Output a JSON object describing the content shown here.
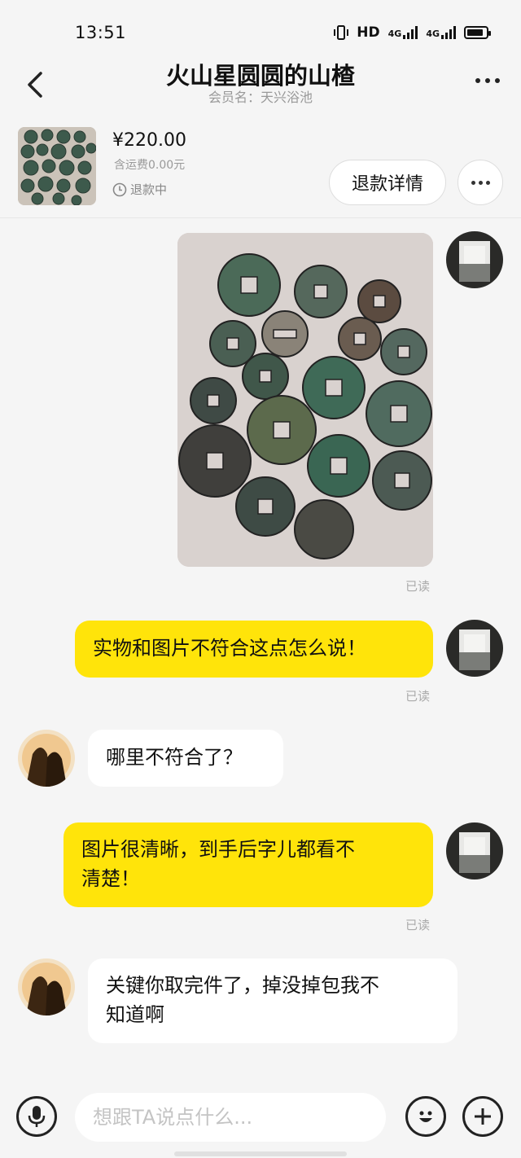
{
  "status_bar": {
    "time": "13:51",
    "hd": "HD",
    "net1": "4G",
    "net2": "4G"
  },
  "header": {
    "title": "火山星圆圆的山楂",
    "subtitle": "会员名：天兴浴池"
  },
  "order": {
    "price": "¥220.00",
    "shipping": "含运费0.00元",
    "status": "退款中",
    "refund_button": "退款详情"
  },
  "messages": [
    {
      "from": "me",
      "type": "image",
      "read": "已读"
    },
    {
      "from": "me",
      "type": "text",
      "text": "实物和图片不符合这点怎么说！",
      "read": "已读"
    },
    {
      "from": "them",
      "type": "text",
      "text": "哪里不符合了？"
    },
    {
      "from": "me",
      "type": "text",
      "text_line1": "图片很清晰，到手后字儿都看不",
      "text_line2": "清楚！",
      "read": "已读"
    },
    {
      "from": "them",
      "type": "text",
      "text_line1": "关键你取完件了，掉没掉包我不",
      "text_line2": "知道啊"
    }
  ],
  "input": {
    "placeholder": "想跟TA说点什么..."
  },
  "colors": {
    "my_bubble": "#ffe40a",
    "their_bubble": "#ffffff",
    "background": "#f5f5f5"
  },
  "icons": [
    "back-arrow-icon",
    "more-icon",
    "clock-icon",
    "microphone-icon",
    "emoji-icon",
    "plus-icon"
  ]
}
